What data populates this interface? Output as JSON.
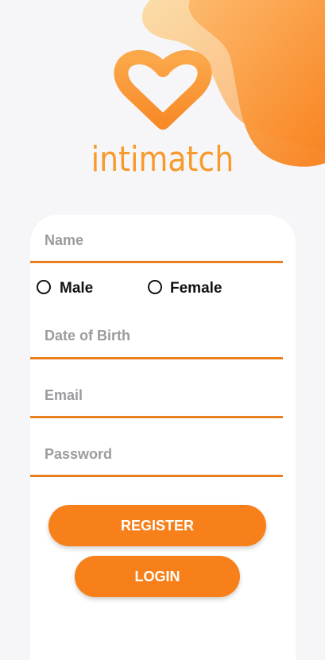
{
  "colors": {
    "accent": "#f8801a",
    "underline": "#e8801f",
    "label": "#9c9ca0",
    "logo": "#f89a2c"
  },
  "brand": {
    "name": "intimatch",
    "logo_icon": "heart-icon"
  },
  "form": {
    "name_placeholder": "Name",
    "gender": {
      "male_label": "Male",
      "female_label": "Female"
    },
    "dob_placeholder": "Date of Birth",
    "email_placeholder": "Email",
    "password_placeholder": "Password"
  },
  "buttons": {
    "register_label": "REGISTER",
    "login_label": "LOGIN"
  }
}
